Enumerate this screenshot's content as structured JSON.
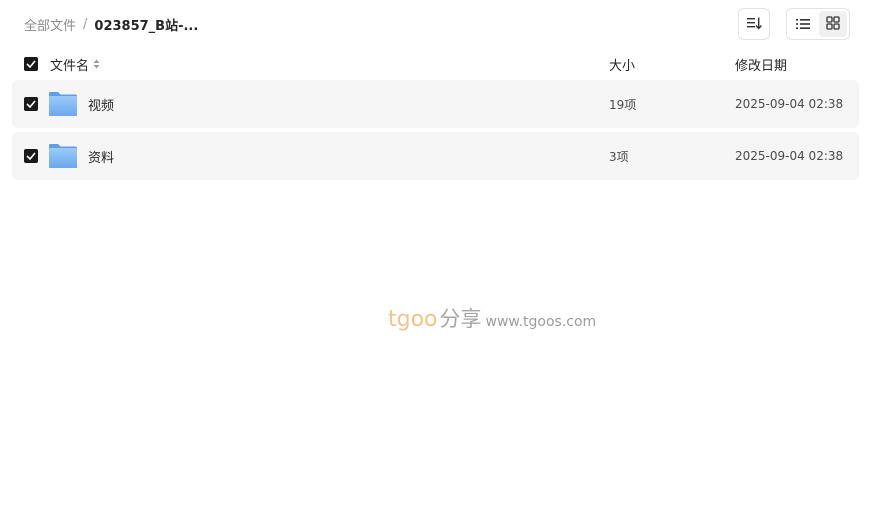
{
  "breadcrumb": {
    "root": "全部文件",
    "separator": "/",
    "current": "023857_B站-..."
  },
  "toolbar": {
    "sort_icon": "sort-order-icon",
    "list_view_icon": "list-view-icon",
    "grid_view_icon": "grid-view-icon",
    "active_view": "list"
  },
  "header": {
    "name": "文件名",
    "size": "大小",
    "date": "修改日期",
    "all_checked": true
  },
  "rows": [
    {
      "name": "视频",
      "size": "19项",
      "date": "2025-09-04 02:38",
      "checked": true,
      "type": "folder"
    },
    {
      "name": "资料",
      "size": "3项",
      "date": "2025-09-04 02:38",
      "checked": true,
      "type": "folder"
    }
  ],
  "watermark": {
    "brand": "tgoo",
    "cn": "分享",
    "url": "www.tgoos.com"
  },
  "colors": {
    "row_bg": "#f5f5f5",
    "checkbox": "#1a1a1a",
    "folder": "#7fb5ee",
    "watermark_brand": "#f2c48a"
  }
}
